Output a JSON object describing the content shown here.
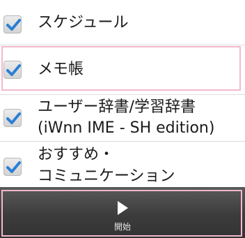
{
  "items": [
    {
      "label": "スケジュール",
      "checked": true
    },
    {
      "label": "メモ帳",
      "checked": true
    },
    {
      "label_line1": "ユーザー辞書/学習辞書",
      "label_line2": "(iWnn IME - SH edition)",
      "checked": true
    },
    {
      "label_line1": "おすすめ・",
      "label_line2": "コミュニケーション",
      "checked": true
    }
  ],
  "bottom_bar": {
    "start_label": "開始",
    "start_icon": "play-icon"
  },
  "colors": {
    "check_blue": "#2a7fd4",
    "highlight_pink": "#f2b8cf",
    "bar_dark": "#3c3c3c"
  }
}
